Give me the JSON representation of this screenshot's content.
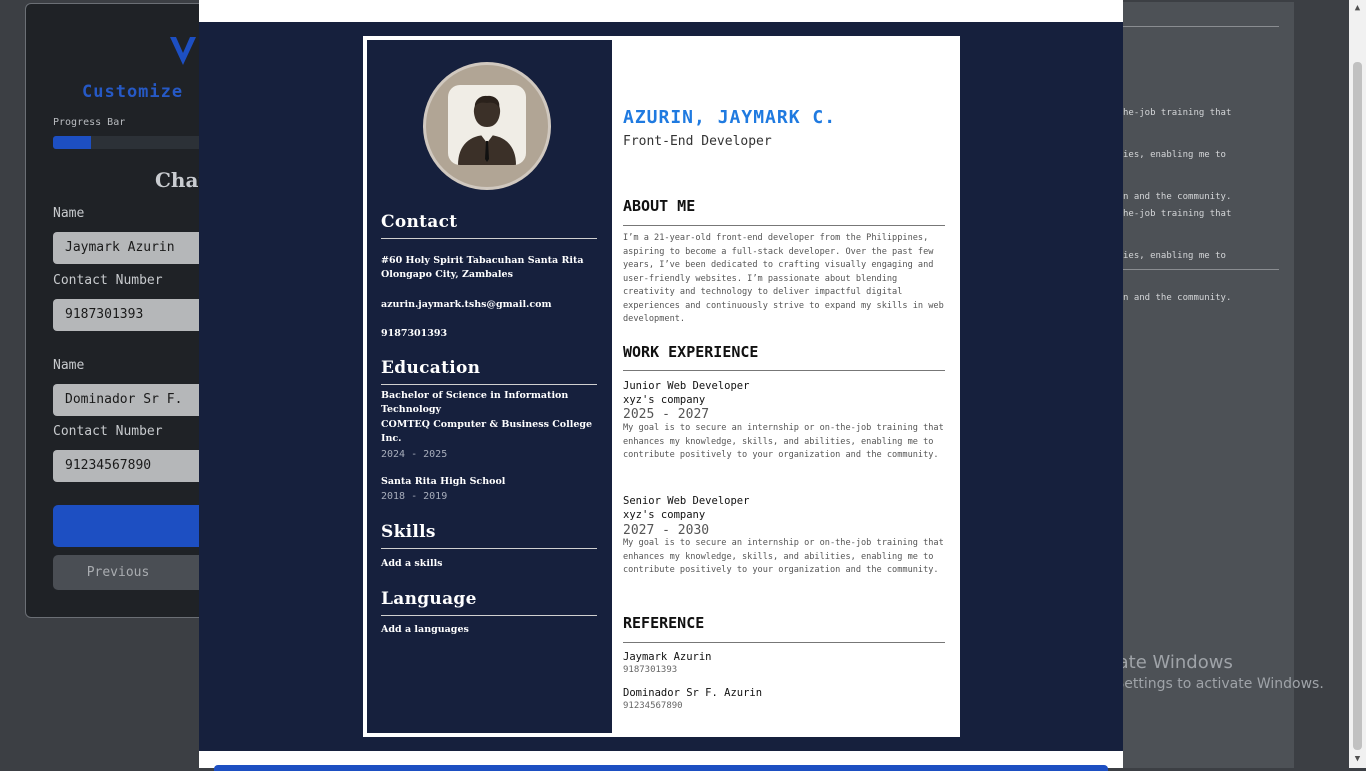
{
  "form": {
    "title": "Customize",
    "progress_label": "Progress Bar",
    "progress_value": 0.25,
    "heading": "Char",
    "ref1_name_label": "Name",
    "ref1_name_value": "Jaymark Azurin",
    "ref1_contact_label": "Contact Number",
    "ref1_contact_value": "9187301393",
    "ref2_name_label": "Name",
    "ref2_name_value": "Dominador Sr F.",
    "ref2_contact_label": "Contact Number",
    "ref2_contact_value": "91234567890",
    "previous_label": "Previous"
  },
  "bg_right": {
    "lines1": [
      "he-job training that",
      "ies, enabling me to",
      "n and the community."
    ],
    "lines2": [
      "he-job training that",
      "ies, enabling me to",
      "n and the community."
    ]
  },
  "watermark": {
    "line1": "Activate Windows",
    "line2": "Go to Settings to activate Windows."
  },
  "resume": {
    "name": "AZURIN, JAYMARK C.",
    "role": "Front-End Developer",
    "contact": {
      "title": "Contact",
      "address": "#60 Holy Spirit Tabacuhan Santa Rita Olongapo City, Zambales",
      "email": "azurin.jaymark.tshs@gmail.com",
      "phone": "9187301393"
    },
    "education": {
      "title": "Education",
      "items": [
        {
          "degree": "Bachelor of Science in Information Technology",
          "school": "COMTEQ Computer & Business College Inc.",
          "years": "2024 - 2025"
        },
        {
          "degree": "Santa Rita High School",
          "school": "",
          "years": "2018 - 2019"
        }
      ]
    },
    "skills": {
      "title": "Skills",
      "text": "Add a skills"
    },
    "language": {
      "title": "Language",
      "text": "Add a languages"
    },
    "about": {
      "title": "ABOUT ME",
      "text": "I’m a 21-year-old front-end developer from the Philippines, aspiring to become a full-stack developer. Over the past few years, I’ve been dedicated to crafting visually engaging and user-friendly websites. I’m passionate about blending creativity and technology to deliver impactful digital experiences and continuously strive to expand my skills in web development."
    },
    "work": {
      "title": "WORK EXPERIENCE",
      "jobs": [
        {
          "position": "Junior Web Developer",
          "company": "xyz's company",
          "dates": "2025 - 2027",
          "desc": "My goal is to secure an internship or on-the-job training that enhances my knowledge, skills, and abilities, enabling me to contribute positively to your organization and the community."
        },
        {
          "position": "Senior Web Developer",
          "company": "xyz's company",
          "dates": "2027 - 2030",
          "desc": "My goal is to secure an internship or on-the-job training that enhances my knowledge, skills, and abilities, enabling me to contribute positively to your organization and the community."
        }
      ]
    },
    "reference": {
      "title": "REFERENCE",
      "items": [
        {
          "name": "Jaymark Azurin",
          "number": "9187301393"
        },
        {
          "name": "Dominador Sr F. Azurin",
          "number": "91234567890"
        }
      ]
    }
  },
  "icons": {
    "logo": "logo-icon",
    "avatar": "user-avatar-icon",
    "scroll_up": "chevron-up-icon",
    "scroll_down": "chevron-down-icon"
  },
  "colors": {
    "accent": "#1d4fc2",
    "resume_sidebar": "#16203d",
    "name": "#1f7ae0"
  }
}
